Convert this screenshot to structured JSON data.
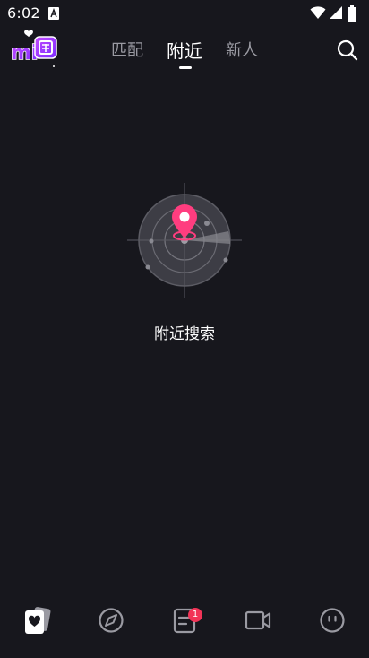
{
  "status_bar": {
    "time": "6:02",
    "notification_icon": "a-text-icon",
    "icons": [
      "wifi-icon",
      "signal-icon",
      "battery-icon"
    ]
  },
  "header": {
    "logo_text": "mi圈",
    "tabs": [
      {
        "label": "匹配",
        "active": false
      },
      {
        "label": "附近",
        "active": true
      },
      {
        "label": "新人",
        "active": false
      }
    ],
    "search_icon": "search-icon"
  },
  "main": {
    "illustration": "radar-location-icon",
    "empty_text": "附近搜索"
  },
  "bottom_nav": {
    "items": [
      {
        "icon": "cards-icon",
        "active": true
      },
      {
        "icon": "compass-icon",
        "active": false
      },
      {
        "icon": "messages-icon",
        "badge": "1",
        "active": false
      },
      {
        "icon": "video-icon",
        "active": false
      },
      {
        "icon": "profile-face-icon",
        "active": false
      }
    ]
  },
  "colors": {
    "background": "#17171d",
    "accent": "#ff3d7f",
    "badge": "#f23457",
    "tab_inactive": "#9a9aa2"
  }
}
